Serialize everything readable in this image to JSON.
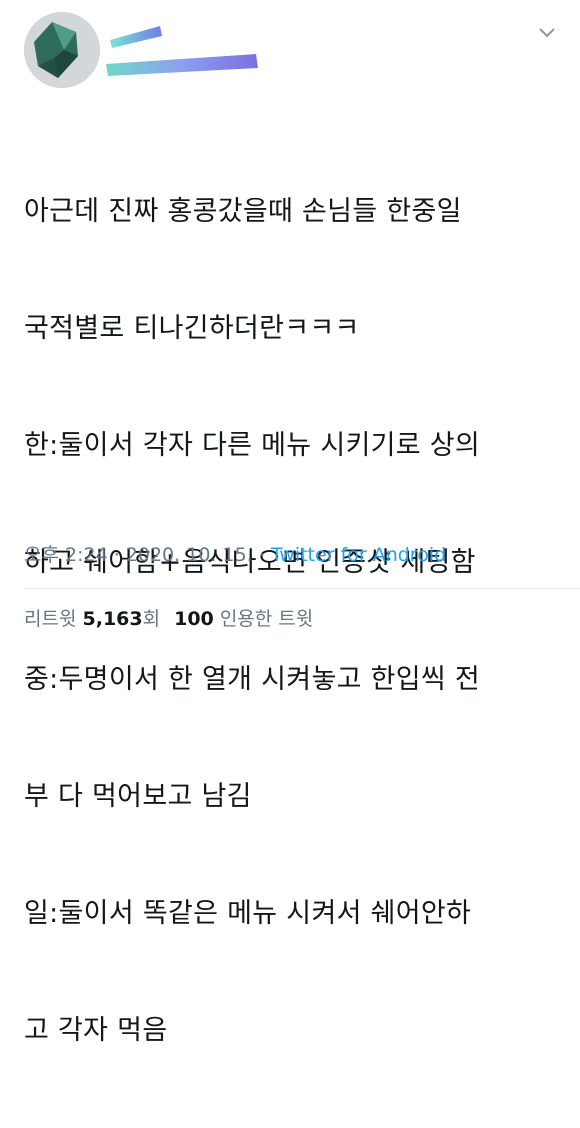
{
  "tweet": {
    "body_lines": [
      "아근데 진짜 홍콩갔을때 손님들 한중일",
      "국적별로 티나긴하더란ㅋㅋㅋ",
      "한:둘이서 각자 다른 메뉴 시키기로 상의",
      "하고 쉐어함+음식나오면 인증샷 세팅함",
      "중:두명이서 한 열개 시켜놓고 한입씩 전",
      "부 다 먹어보고 남김",
      "일:둘이서 똑같은 메뉴 시켜서 쉐어안하",
      "고 각자 먹음"
    ],
    "time": "오후 2:24",
    "separator": " · ",
    "date": "2020. 10. 15.",
    "source": "Twitter for Android",
    "retweets_label": "리트윗",
    "retweets_count": "5,163",
    "retweets_suffix": "회",
    "quotes_count": "100",
    "quotes_label": "인용한 트윗"
  },
  "icons": {
    "menu": "chevron-down-icon",
    "avatar": "avatar-image"
  },
  "colors": {
    "text": "#14171a",
    "secondary": "#657786",
    "link": "#1da1f2",
    "divider": "#e1e8ed"
  }
}
